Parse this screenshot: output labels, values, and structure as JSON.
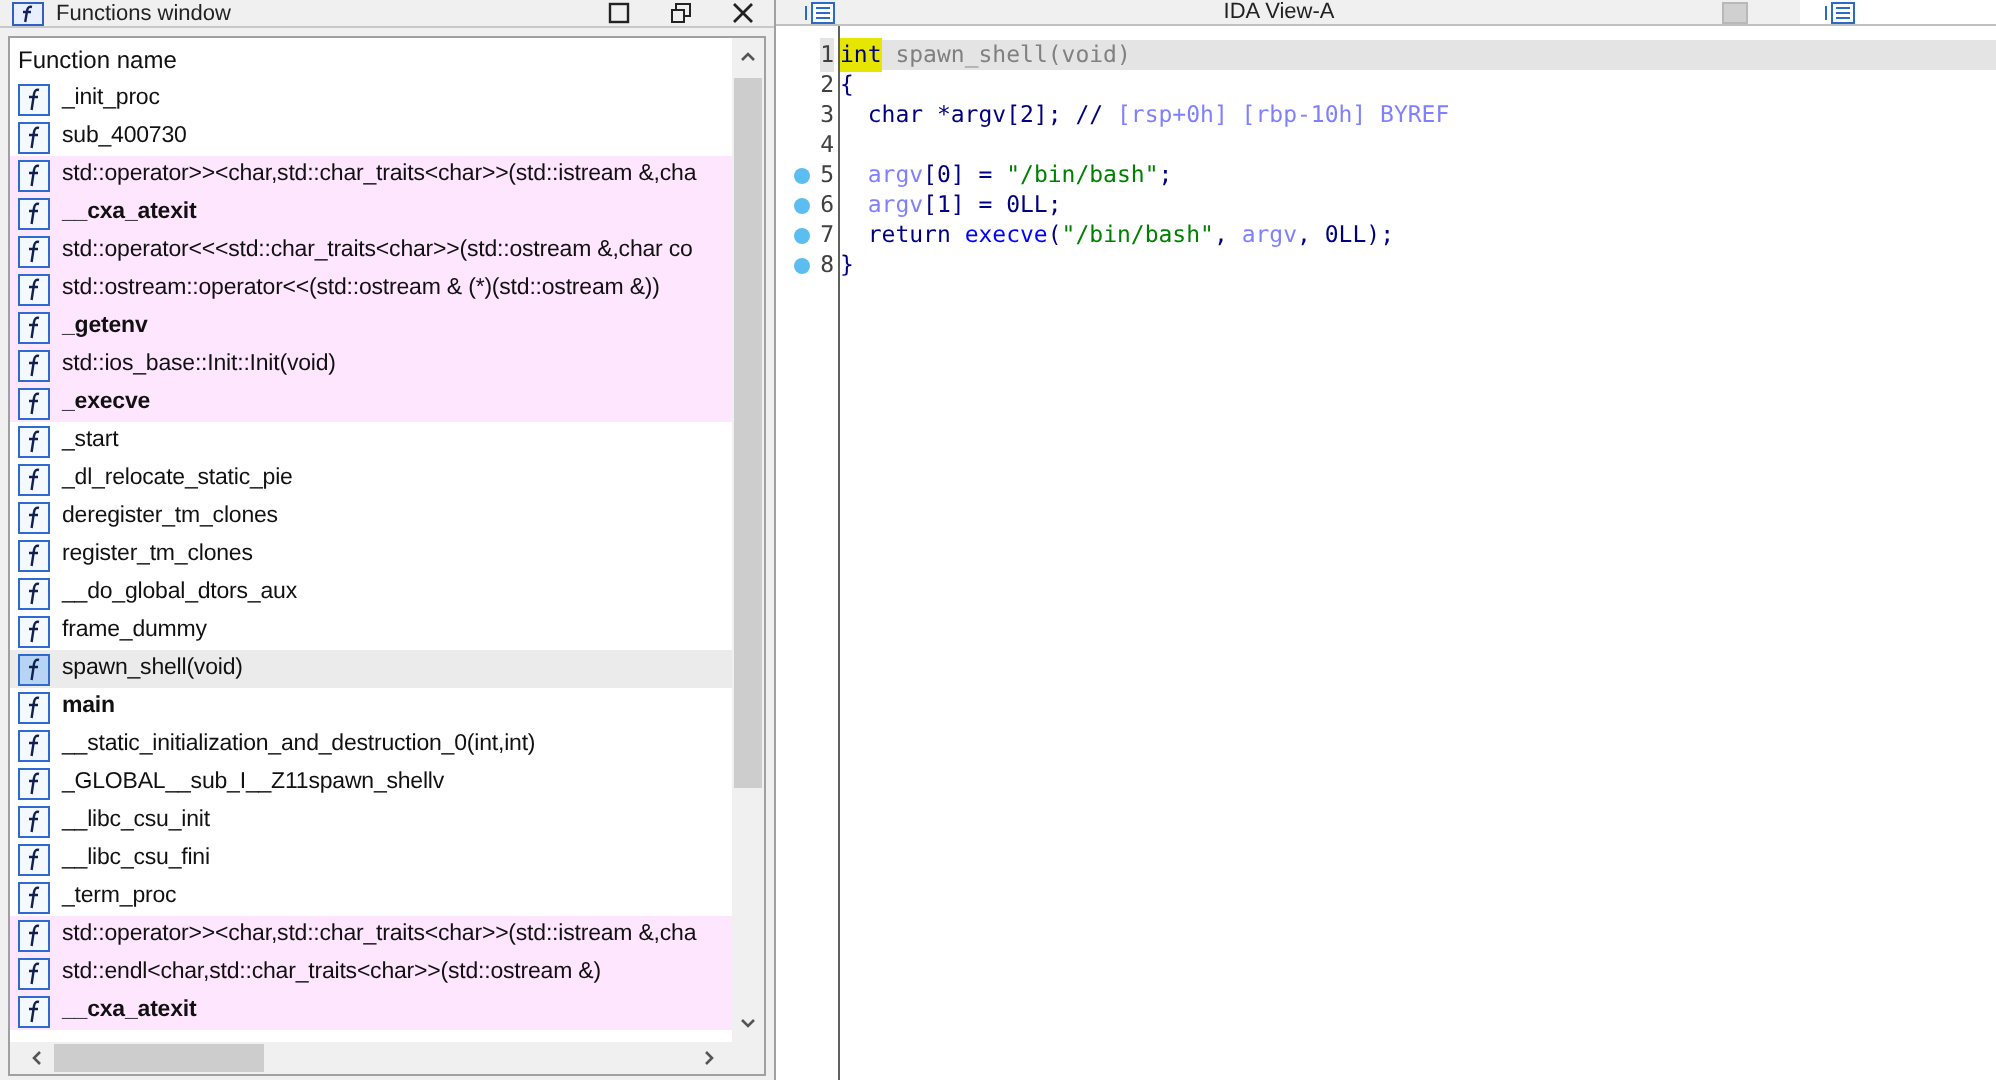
{
  "functions_window": {
    "title": "Functions window",
    "column_header": "Function name",
    "rows": [
      {
        "name": "_init_proc",
        "bold": false,
        "library": false,
        "selected": false
      },
      {
        "name": "sub_400730",
        "bold": false,
        "library": false,
        "selected": false
      },
      {
        "name": "std::operator>><char,std::char_traits<char>>(std::istream &,cha",
        "bold": false,
        "library": true,
        "selected": false
      },
      {
        "name": "__cxa_atexit",
        "bold": true,
        "library": true,
        "selected": false
      },
      {
        "name": "std::operator<<<std::char_traits<char>>(std::ostream &,char co",
        "bold": false,
        "library": true,
        "selected": false
      },
      {
        "name": "std::ostream::operator<<(std::ostream & (*)(std::ostream &))",
        "bold": false,
        "library": true,
        "selected": false
      },
      {
        "name": "_getenv",
        "bold": true,
        "library": true,
        "selected": false
      },
      {
        "name": "std::ios_base::Init::Init(void)",
        "bold": false,
        "library": true,
        "selected": false
      },
      {
        "name": "_execve",
        "bold": true,
        "library": true,
        "selected": false
      },
      {
        "name": "_start",
        "bold": false,
        "library": false,
        "selected": false
      },
      {
        "name": "_dl_relocate_static_pie",
        "bold": false,
        "library": false,
        "selected": false
      },
      {
        "name": "deregister_tm_clones",
        "bold": false,
        "library": false,
        "selected": false
      },
      {
        "name": "register_tm_clones",
        "bold": false,
        "library": false,
        "selected": false
      },
      {
        "name": "__do_global_dtors_aux",
        "bold": false,
        "library": false,
        "selected": false
      },
      {
        "name": "frame_dummy",
        "bold": false,
        "library": false,
        "selected": false
      },
      {
        "name": "spawn_shell(void)",
        "bold": false,
        "library": false,
        "selected": true
      },
      {
        "name": "main",
        "bold": true,
        "library": false,
        "selected": false
      },
      {
        "name": "__static_initialization_and_destruction_0(int,int)",
        "bold": false,
        "library": false,
        "selected": false
      },
      {
        "name": "_GLOBAL__sub_I__Z11spawn_shellv",
        "bold": false,
        "library": false,
        "selected": false
      },
      {
        "name": "__libc_csu_init",
        "bold": false,
        "library": false,
        "selected": false
      },
      {
        "name": "__libc_csu_fini",
        "bold": false,
        "library": false,
        "selected": false
      },
      {
        "name": "_term_proc",
        "bold": false,
        "library": false,
        "selected": false
      },
      {
        "name": "std::operator>><char,std::char_traits<char>>(std::istream &,cha",
        "bold": false,
        "library": true,
        "selected": false
      },
      {
        "name": "std::endl<char,std::char_traits<char>>(std::ostream &)",
        "bold": false,
        "library": true,
        "selected": false
      },
      {
        "name": "__cxa_atexit",
        "bold": true,
        "library": true,
        "selected": false
      }
    ]
  },
  "pseudocode": {
    "tab_title": "IDA View-A",
    "lines": [
      {
        "number": "1",
        "breakpoint": false,
        "current": true,
        "tokens": [
          {
            "kind": "keyword_highlight",
            "text": "int"
          },
          {
            "kind": "name",
            "text": " spawn_shell(void)"
          }
        ]
      },
      {
        "number": "2",
        "breakpoint": false,
        "current": false,
        "tokens": [
          {
            "kind": "plain",
            "text": "{"
          }
        ]
      },
      {
        "number": "3",
        "breakpoint": false,
        "current": false,
        "tokens": [
          {
            "kind": "plain",
            "text": "  char *argv[2]; //"
          },
          {
            "kind": "comment",
            "text": " [rsp+0h] [rbp-10h] BYREF"
          }
        ]
      },
      {
        "number": "4",
        "breakpoint": false,
        "current": false
      },
      {
        "number": "5",
        "breakpoint": true,
        "current": false,
        "tokens": [
          {
            "kind": "variable",
            "text": "  argv"
          },
          {
            "kind": "plain",
            "text": "[0] = "
          },
          {
            "kind": "string",
            "text": "\"/bin/bash\""
          },
          {
            "kind": "plain",
            "text": ";"
          }
        ]
      },
      {
        "number": "6",
        "breakpoint": true,
        "current": false,
        "tokens": [
          {
            "kind": "variable",
            "text": "  argv"
          },
          {
            "kind": "plain",
            "text": "[1] = 0LL;"
          }
        ]
      },
      {
        "number": "7",
        "breakpoint": true,
        "current": false,
        "tokens": [
          {
            "kind": "plain",
            "text": "  return "
          },
          {
            "kind": "function",
            "text": "execve"
          },
          {
            "kind": "plain",
            "text": "("
          },
          {
            "kind": "string",
            "text": "\"/bin/bash\""
          },
          {
            "kind": "plain",
            "text": ", "
          },
          {
            "kind": "variable",
            "text": "argv"
          },
          {
            "kind": "plain",
            "text": ", 0LL);"
          }
        ]
      },
      {
        "number": "8",
        "breakpoint": true,
        "current": false,
        "tokens": [
          {
            "kind": "plain",
            "text": "}"
          }
        ]
      }
    ]
  }
}
